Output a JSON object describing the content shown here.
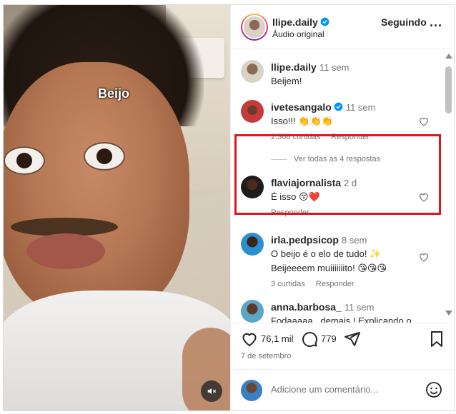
{
  "video": {
    "overlay_text": "Beijo"
  },
  "header": {
    "username": "llipe.daily",
    "subtitle": "Áudio original",
    "follow_label": "Seguindo",
    "more_label": "..."
  },
  "caption": {
    "username": "llipe.daily",
    "time": "11 sem",
    "text": "Beijem!"
  },
  "comments": [
    {
      "username": "ivetesangalo",
      "verified": true,
      "time": "11 sem",
      "text": "Isso!!! 👏👏👏",
      "likes": "2.368 curtidas",
      "reply_label": "Responder",
      "replies": "Ver todas as 4 respostas"
    },
    {
      "username": "flaviajornalista",
      "time": "2 d",
      "text": "É isso 😚❤️",
      "reply_label": "Responder"
    },
    {
      "username": "irla.pedpsicop",
      "time": "8 sem",
      "text": "O beijo é o elo de tudo! ✨ Beijeeeem muiiiiiiito! 😘😘😘",
      "likes": "3 curtidas",
      "reply_label": "Responder"
    },
    {
      "username": "anna.barbosa_",
      "time": "11 sem",
      "text": "Fodaaaaa , demais ! Explicando o"
    }
  ],
  "actions": {
    "likes": "76,1 mil",
    "comments": "779",
    "date": "7 de setembro"
  },
  "compose": {
    "placeholder": "Adicione um comentário..."
  },
  "colors": {
    "highlight": "#e0161e",
    "verified": "#0095f6"
  }
}
